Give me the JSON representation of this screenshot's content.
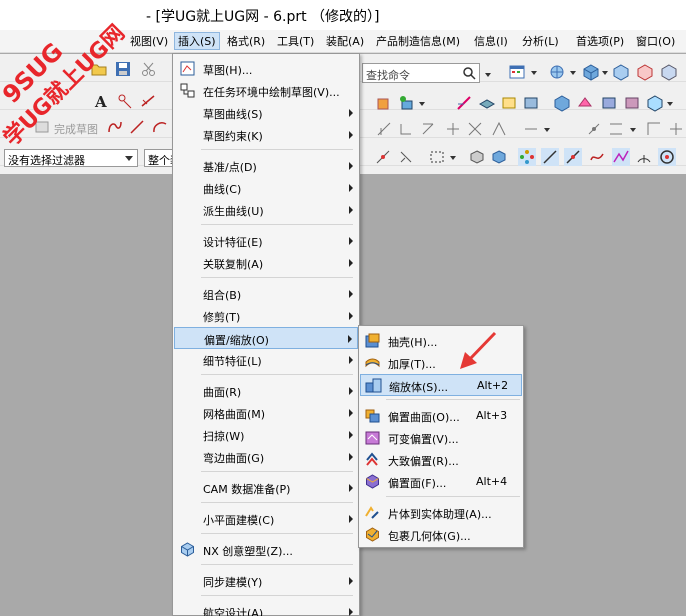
{
  "window": {
    "title": "- [学UG就上UG网 - 6.prt （修改的）]"
  },
  "watermark": {
    "line1": "9SUG",
    "line2": "学UG就上UG网"
  },
  "menubar": {
    "items": [
      {
        "label": "视图(V)"
      },
      {
        "label": "插入(S)"
      },
      {
        "label": "格式(R)"
      },
      {
        "label": "工具(T)"
      },
      {
        "label": "装配(A)"
      },
      {
        "label": "产品制造信息(M)"
      },
      {
        "label": "信息(I)"
      },
      {
        "label": "分析(L)"
      },
      {
        "label": "首选项(P)"
      },
      {
        "label": "窗口(O)"
      }
    ]
  },
  "toolbar": {
    "find_command_placeholder": "查找命令",
    "finish_sketch_label": "完成草图",
    "filter_value": "没有选择过滤器",
    "scope_value": "整个装配"
  },
  "insert_menu": {
    "items": [
      {
        "label": "草图(H)...",
        "submenu": false
      },
      {
        "label": "在任务环境中绘制草图(V)...",
        "submenu": false
      },
      {
        "label": "草图曲线(S)",
        "submenu": true
      },
      {
        "label": "草图约束(K)",
        "submenu": true
      },
      {
        "label": "基准/点(D)",
        "submenu": true
      },
      {
        "label": "曲线(C)",
        "submenu": true
      },
      {
        "label": "派生曲线(U)",
        "submenu": true
      },
      {
        "label": "设计特征(E)",
        "submenu": true
      },
      {
        "label": "关联复制(A)",
        "submenu": true
      },
      {
        "label": "组合(B)",
        "submenu": true
      },
      {
        "label": "修剪(T)",
        "submenu": true
      },
      {
        "label": "偏置/缩放(O)",
        "submenu": true,
        "highlighted": true
      },
      {
        "label": "细节特征(L)",
        "submenu": true
      },
      {
        "label": "曲面(R)",
        "submenu": true
      },
      {
        "label": "网格曲面(M)",
        "submenu": true
      },
      {
        "label": "扫掠(W)",
        "submenu": true
      },
      {
        "label": "弯边曲面(G)",
        "submenu": true
      },
      {
        "label": "CAM 数据准备(P)",
        "submenu": true
      },
      {
        "label": "小平面建模(C)",
        "submenu": true
      },
      {
        "label": "NX 创意塑型(Z)...",
        "submenu": false
      },
      {
        "label": "同步建模(Y)",
        "submenu": true
      },
      {
        "label": "航空设计(A)",
        "submenu": true
      }
    ]
  },
  "offset_scale_menu": {
    "items": [
      {
        "label": "抽壳(H)...",
        "shortcut": ""
      },
      {
        "label": "加厚(T)...",
        "shortcut": ""
      },
      {
        "label": "缩放体(S)...",
        "shortcut": "Alt+2",
        "highlighted": true
      },
      {
        "label": "偏置曲面(O)...",
        "shortcut": "Alt+3"
      },
      {
        "label": "可变偏置(V)...",
        "shortcut": ""
      },
      {
        "label": "大致偏置(R)...",
        "shortcut": ""
      },
      {
        "label": "偏置面(F)...",
        "shortcut": "Alt+4"
      },
      {
        "label": "片体到实体助理(A)...",
        "shortcut": ""
      },
      {
        "label": "包裹几何体(G)...",
        "shortcut": ""
      }
    ]
  },
  "colors": {
    "highlight": "#cfe3f7",
    "highlight_border": "#7fb0e0",
    "watermark_red": "#e8262b",
    "annotation_arrow": "#e53935"
  }
}
